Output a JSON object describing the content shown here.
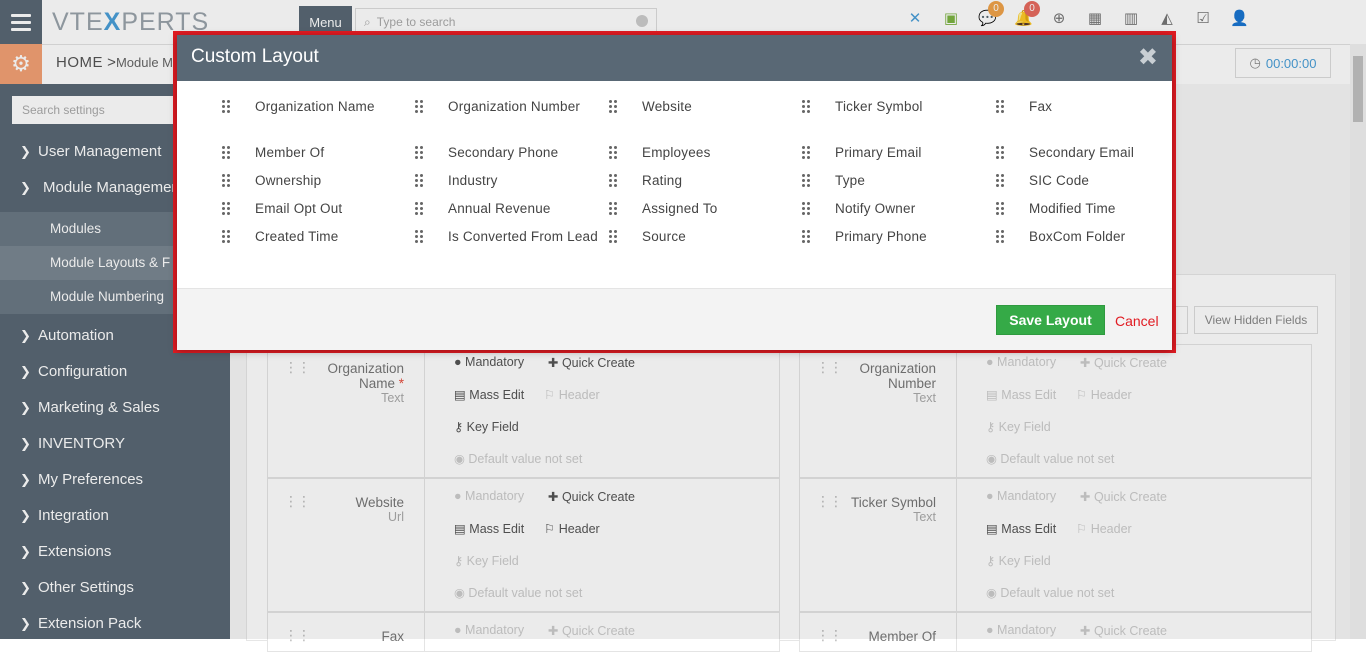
{
  "topbar": {
    "logo_prefix": "VTE",
    "logo_x": "X",
    "logo_suffix": "PERTS",
    "menu_label": "Menu",
    "search_placeholder": "Type to search",
    "notif_count_chat": "0",
    "notif_count_bell": "0",
    "timer": "00:00:00"
  },
  "breadcrumb": {
    "home": "HOME",
    "separator": ">",
    "current": "Module Mar"
  },
  "sidebar": {
    "search_placeholder": "Search settings",
    "items": [
      {
        "label": "User Management",
        "expanded": false
      },
      {
        "label": "Module Management",
        "expanded": true
      },
      {
        "label": "Automation",
        "expanded": false
      },
      {
        "label": "Configuration",
        "expanded": false
      },
      {
        "label": "Marketing & Sales",
        "expanded": false
      },
      {
        "label": "INVENTORY",
        "expanded": false
      },
      {
        "label": "My Preferences",
        "expanded": false
      },
      {
        "label": "Integration",
        "expanded": false
      },
      {
        "label": "Extensions",
        "expanded": false
      },
      {
        "label": "Other Settings",
        "expanded": false
      },
      {
        "label": "Extension Pack",
        "expanded": false
      }
    ],
    "subitems": [
      {
        "label": "Modules"
      },
      {
        "label": "Module Layouts & F"
      },
      {
        "label": "Module Numbering"
      }
    ]
  },
  "background": {
    "view_hidden_fields": "View Hidden Fields",
    "cards": [
      {
        "label1": "Organization",
        "label2": "Name",
        "required": "*",
        "type": "Text",
        "opts": [
          "Mandatory",
          "Quick Create",
          "Mass Edit",
          "Header",
          "Key Field",
          "Default value not set"
        ]
      },
      {
        "label1": "Organization",
        "label2": "Number",
        "required": "",
        "type": "Text",
        "opts": [
          "Mandatory",
          "Quick Create",
          "Mass Edit",
          "Header",
          "Key Field",
          "Default value not set"
        ]
      },
      {
        "label1": "Website",
        "label2": "",
        "required": "",
        "type": "Url",
        "opts": [
          "Mandatory",
          "Quick Create",
          "Mass Edit",
          "Header",
          "Key Field",
          "Default value not set"
        ]
      },
      {
        "label1": "Ticker Symbol",
        "label2": "",
        "required": "",
        "type": "Text",
        "opts": [
          "Mandatory",
          "Quick Create",
          "Mass Edit",
          "Header",
          "Key Field",
          "Default value not set"
        ]
      },
      {
        "label1": "Fax",
        "label2": "",
        "required": "",
        "type": "",
        "opts": [
          "Mandatory",
          "Quick Create"
        ]
      },
      {
        "label1": "Member Of",
        "label2": "",
        "required": "",
        "type": "",
        "opts": [
          "Mandatory",
          "Quick Create"
        ]
      }
    ]
  },
  "modal": {
    "title": "Custom Layout",
    "close": "✖",
    "save_label": "Save Layout",
    "cancel_label": "Cancel",
    "fields": [
      [
        "Organization Name",
        "Organization Number",
        "Website",
        "Ticker Symbol",
        "Fax"
      ],
      [
        "Member Of",
        "Secondary Phone",
        "Employees",
        "Primary Email",
        "Secondary Email"
      ],
      [
        "Ownership",
        "Industry",
        "Rating",
        "Type",
        "SIC Code"
      ],
      [
        "Email Opt Out",
        "Annual Revenue",
        "Assigned To",
        "Notify Owner",
        "Modified Time"
      ],
      [
        "Created Time",
        "Is Converted From Lead",
        "Source",
        "Primary Phone",
        "BoxCom Folder"
      ]
    ]
  },
  "colors": {
    "header": "#596875",
    "accent_red": "#e11b22",
    "save_green": "#35aa47",
    "gear_orange": "#f4a175"
  },
  "icons": [
    "hamburger-icon",
    "search-icon",
    "x-app-icon",
    "calendar-check-icon",
    "chat-icon",
    "bell-icon",
    "plus-circle-icon",
    "calendar-icon",
    "bar-chart-icon",
    "area-chart-icon",
    "checkbox-icon",
    "user-icon",
    "gear-icon",
    "clock-icon",
    "close-icon",
    "drag-handle-icon"
  ]
}
